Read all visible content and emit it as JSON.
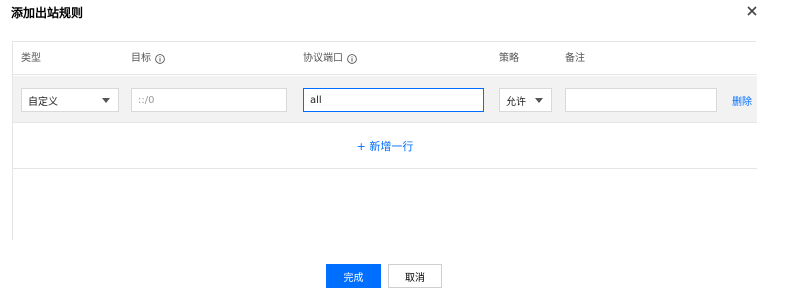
{
  "dialog": {
    "title": "添加出站规则"
  },
  "table": {
    "headers": {
      "type": "类型",
      "target": "目标",
      "protocol_port": "协议端口",
      "policy": "策略",
      "remark": "备注"
    },
    "row": {
      "type": "自定义",
      "target_value": "::/0",
      "protocol_port_value": "all",
      "policy": "允许",
      "remark_value": "",
      "delete_label": "删除"
    },
    "add_row_label": "+ 新增一行"
  },
  "footer": {
    "confirm_label": "完成",
    "cancel_label": "取消"
  },
  "colors": {
    "accent": "#006eff",
    "row_bg": "#f2f2f2",
    "border": "#e5e5e5"
  },
  "icons": {
    "close": "close-icon",
    "info": "info-icon",
    "dropdown": "chevron-down-icon"
  }
}
